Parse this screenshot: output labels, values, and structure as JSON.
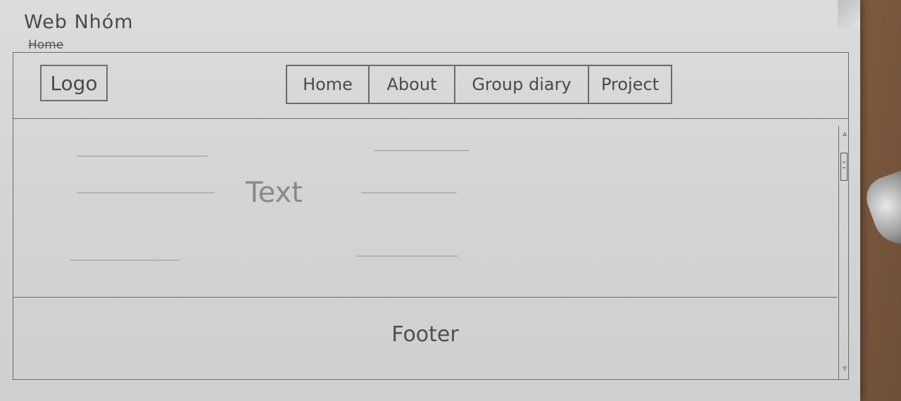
{
  "sketch": {
    "site_title": "Web Nhóm",
    "page_name": "Home"
  },
  "header": {
    "logo_label": "Logo",
    "nav": [
      {
        "label": "Home"
      },
      {
        "label": "About"
      },
      {
        "label": "Group diary"
      },
      {
        "label": "Project"
      }
    ]
  },
  "content": {
    "label": "Text"
  },
  "scrollbar": {
    "up_icon": "▵",
    "down_icon": "▿"
  },
  "footer": {
    "label": "Footer"
  },
  "colors": {
    "paper": "#d6d6d6",
    "pencil": "#4a4a4a",
    "faint_pencil": "#b3b3b3"
  }
}
